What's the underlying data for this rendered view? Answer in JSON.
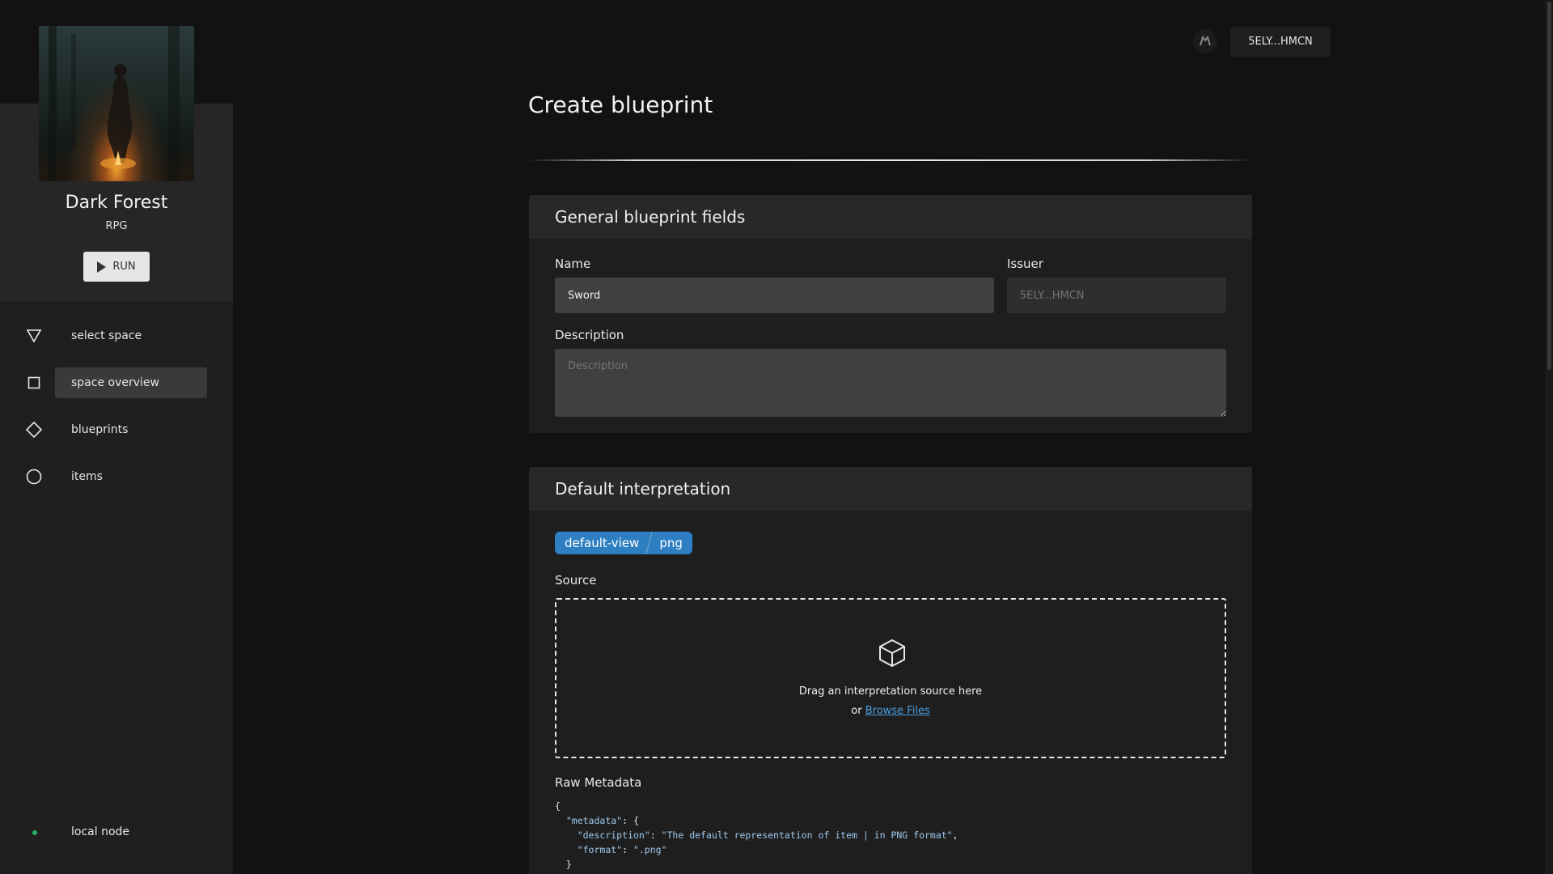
{
  "space": {
    "title": "Dark Forest",
    "genre": "RPG",
    "run_label": "RUN"
  },
  "sidebar": {
    "items": [
      {
        "label": "select space",
        "icon": "triangle-down-icon"
      },
      {
        "label": "space overview",
        "icon": "square-icon",
        "active": true
      },
      {
        "label": "blueprints",
        "icon": "diamond-icon"
      },
      {
        "label": "items",
        "icon": "circle-icon"
      }
    ],
    "node": {
      "label": "local node",
      "status_color": "#27ae60"
    }
  },
  "header": {
    "account_label": "5ELY...HMCN"
  },
  "page": {
    "title": "Create blueprint"
  },
  "general": {
    "title": "General blueprint fields",
    "name_label": "Name",
    "name_value": "Sword",
    "issuer_label": "Issuer",
    "issuer_placeholder": "5ELY...HMCN",
    "description_label": "Description",
    "description_placeholder": "Description"
  },
  "interpretation": {
    "title": "Default interpretation",
    "tags": [
      "default-view",
      "png"
    ],
    "source_label": "Source",
    "drop_text": "Drag an interpretation source here",
    "drop_or": "or",
    "browse_label": "Browse Files",
    "raw_label": "Raw Metadata",
    "raw_lines": {
      "l1": "{",
      "l2_key": "\"metadata\"",
      "l2_rest": ": {",
      "l3_key": "\"description\"",
      "l3_colon": ": ",
      "l3_val": "\"The default representation of item | in PNG format\"",
      "l3_end": ",",
      "l4_key": "\"format\"",
      "l4_colon": ": ",
      "l4_val": "\".png\"",
      "l5": "}"
    }
  },
  "colors": {
    "accent": "#2d7fc1",
    "link": "#4a9fdf",
    "background": "#121212"
  }
}
